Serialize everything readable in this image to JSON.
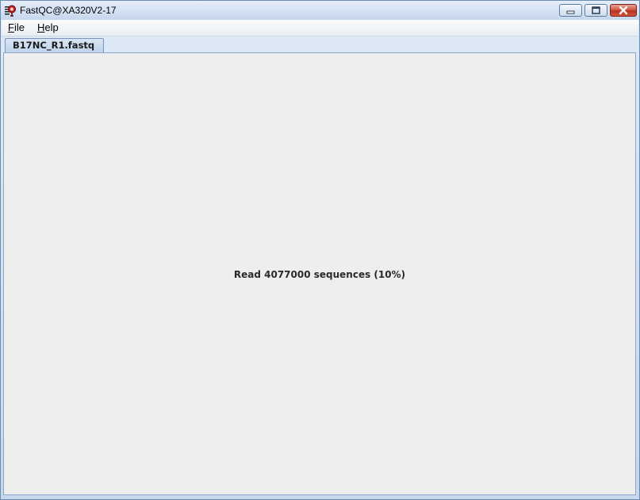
{
  "window": {
    "title": "FastQC@XA320V2-17",
    "icon": "fastqc-app-icon"
  },
  "menu": {
    "file_mnemonic": "F",
    "file_rest": "ile",
    "help_mnemonic": "H",
    "help_rest": "elp"
  },
  "tabs": [
    {
      "label": "B17NC_R1.fastq",
      "selected": true
    }
  ],
  "status": {
    "text": "Read 4077000 sequences (10%)"
  },
  "colors": {
    "close_button": "#d35a45",
    "content_background": "#eeeeee"
  }
}
